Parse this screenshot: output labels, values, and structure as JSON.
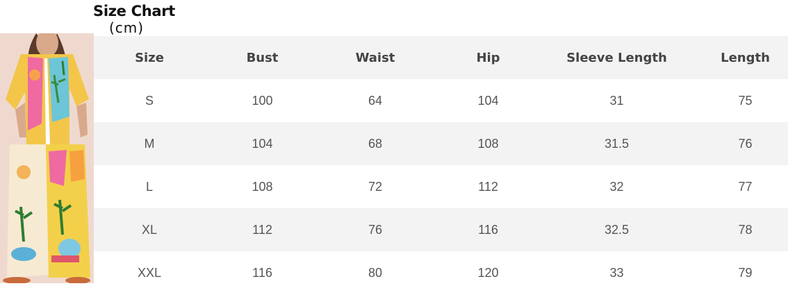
{
  "title": "Size Chart",
  "unit": "(cm)",
  "table": {
    "headers": [
      "Size",
      "Bust",
      "Waist",
      "Hip",
      "Sleeve Length",
      "Length"
    ],
    "rows": [
      [
        "S",
        "100",
        "64",
        "104",
        "31",
        "75"
      ],
      [
        "M",
        "104",
        "68",
        "108",
        "31.5",
        "76"
      ],
      [
        "L",
        "108",
        "72",
        "112",
        "32",
        "77"
      ],
      [
        "XL",
        "112",
        "76",
        "116",
        "32.5",
        "78"
      ],
      [
        "XXL",
        "116",
        "80",
        "120",
        "33",
        "79"
      ]
    ]
  },
  "colors": {
    "row_shade": "#f3f3f3",
    "text": "#555555",
    "header_text": "#444444",
    "title": "#111111"
  }
}
